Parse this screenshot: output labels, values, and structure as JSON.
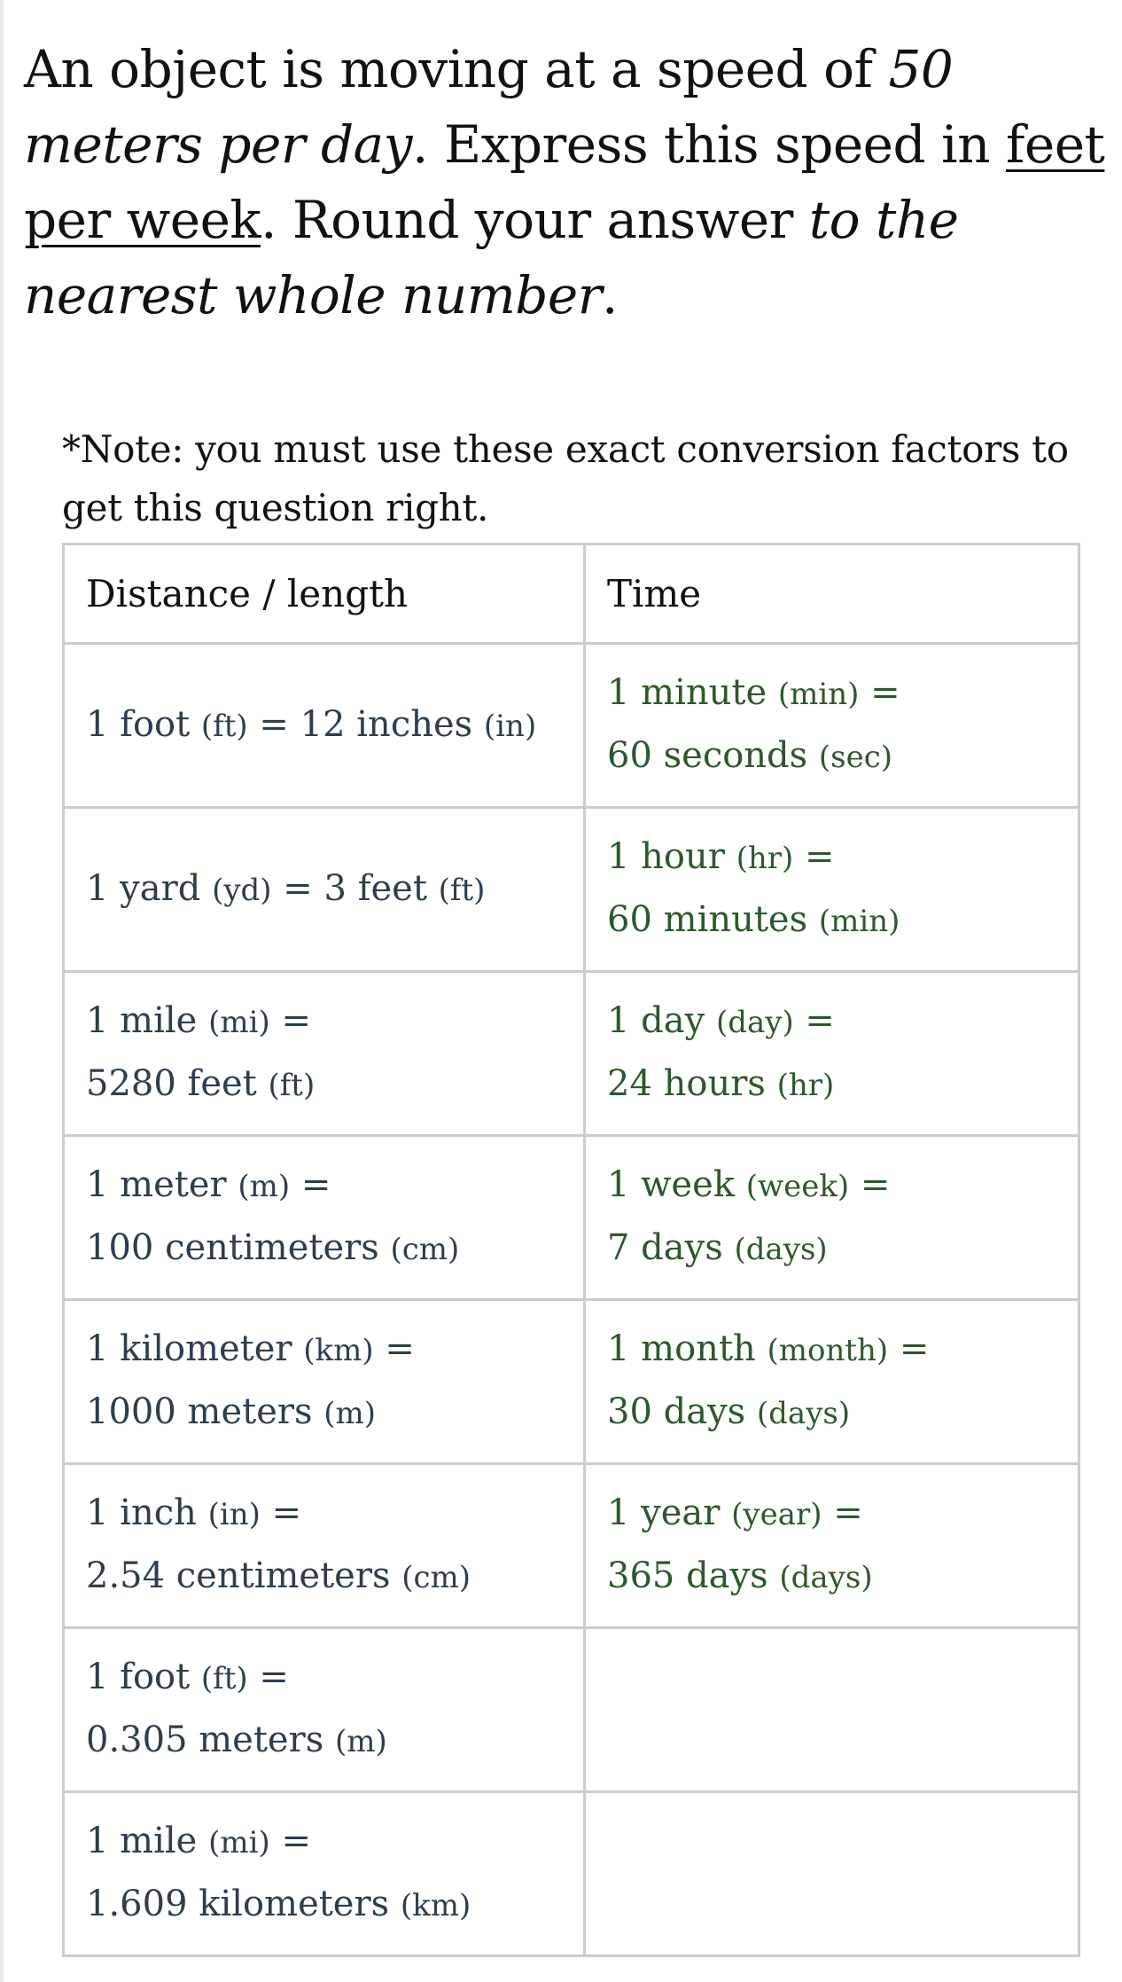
{
  "question": {
    "parts": [
      {
        "text": "An object is moving at a speed of ",
        "style": "normal"
      },
      {
        "text": "50 meters per day",
        "style": "italic"
      },
      {
        "text": ". Express this speed in ",
        "style": "normal"
      },
      {
        "text": "feet per week",
        "style": "underline"
      },
      {
        "text": ". Round your answer ",
        "style": "normal"
      },
      {
        "text": "to the nearest whole number",
        "style": "italic"
      },
      {
        "text": ".",
        "style": "normal"
      }
    ]
  },
  "note": "*Note: you must use these exact conversion factors to get this question right.",
  "colors": {
    "distance_text": "#2c3e50",
    "time_text": "#2b5a2a",
    "table_border": "#cccccc"
  },
  "table": {
    "headers": [
      "Distance / length",
      "Time"
    ],
    "rows": [
      {
        "distance": {
          "lines": [
            [
              [
                "1 foot ",
                ""
              ],
              [
                "(ft)",
                "unit"
              ],
              [
                " = 12 inches ",
                ""
              ],
              [
                "(in)",
                "unit"
              ]
            ]
          ]
        },
        "time": {
          "lines": [
            [
              [
                "1 minute ",
                ""
              ],
              [
                "(min)",
                "unit"
              ],
              [
                " =",
                ""
              ]
            ],
            [
              [
                "60 seconds ",
                ""
              ],
              [
                "(sec)",
                "unit"
              ]
            ]
          ]
        }
      },
      {
        "distance": {
          "lines": [
            [
              [
                "1 yard ",
                ""
              ],
              [
                "(yd)",
                "unit"
              ],
              [
                " = 3 feet ",
                ""
              ],
              [
                "(ft)",
                "unit"
              ]
            ]
          ]
        },
        "time": {
          "lines": [
            [
              [
                "1 hour ",
                ""
              ],
              [
                "(hr)",
                "unit"
              ],
              [
                " =",
                ""
              ]
            ],
            [
              [
                "60 minutes ",
                ""
              ],
              [
                "(min)",
                "unit"
              ]
            ]
          ]
        }
      },
      {
        "distance": {
          "lines": [
            [
              [
                "1 mile ",
                ""
              ],
              [
                "(mi)",
                "unit"
              ],
              [
                " =",
                ""
              ]
            ],
            [
              [
                "5280 feet ",
                ""
              ],
              [
                "(ft)",
                "unit"
              ]
            ]
          ]
        },
        "time": {
          "lines": [
            [
              [
                "1 day ",
                ""
              ],
              [
                "(day)",
                "unit"
              ],
              [
                " =",
                ""
              ]
            ],
            [
              [
                "24 hours ",
                ""
              ],
              [
                "(hr)",
                "unit"
              ]
            ]
          ]
        }
      },
      {
        "distance": {
          "lines": [
            [
              [
                "1 meter ",
                ""
              ],
              [
                "(m)",
                "unit"
              ],
              [
                " =",
                ""
              ]
            ],
            [
              [
                "100 centimeters ",
                ""
              ],
              [
                "(cm)",
                "unit"
              ]
            ]
          ]
        },
        "time": {
          "lines": [
            [
              [
                "1 week ",
                ""
              ],
              [
                "(week)",
                "unit"
              ],
              [
                " =",
                ""
              ]
            ],
            [
              [
                "7 days ",
                ""
              ],
              [
                "(days)",
                "unit"
              ]
            ]
          ]
        }
      },
      {
        "distance": {
          "lines": [
            [
              [
                "1 kilometer ",
                ""
              ],
              [
                "(km)",
                "unit"
              ],
              [
                " =",
                ""
              ]
            ],
            [
              [
                "1000 meters ",
                ""
              ],
              [
                "(m)",
                "unit"
              ]
            ]
          ]
        },
        "time": {
          "lines": [
            [
              [
                "1 month ",
                ""
              ],
              [
                "(month)",
                "unit"
              ],
              [
                " =",
                ""
              ]
            ],
            [
              [
                "30 days ",
                ""
              ],
              [
                "(days)",
                "unit"
              ]
            ]
          ]
        }
      },
      {
        "distance": {
          "lines": [
            [
              [
                "1 inch ",
                ""
              ],
              [
                "(in)",
                "unit"
              ],
              [
                " =",
                ""
              ]
            ],
            [
              [
                "2.54 centimeters ",
                ""
              ],
              [
                "(cm)",
                "unit"
              ]
            ]
          ]
        },
        "time": {
          "lines": [
            [
              [
                "1 year ",
                ""
              ],
              [
                "(year)",
                "unit"
              ],
              [
                " =",
                ""
              ]
            ],
            [
              [
                "365 days ",
                ""
              ],
              [
                "(days)",
                "unit"
              ]
            ]
          ]
        }
      },
      {
        "distance": {
          "lines": [
            [
              [
                "1 foot ",
                ""
              ],
              [
                "(ft)",
                "unit"
              ],
              [
                " =",
                ""
              ]
            ],
            [
              [
                "0.305 meters ",
                ""
              ],
              [
                "(m)",
                "unit"
              ]
            ]
          ]
        },
        "time": {
          "lines": []
        }
      },
      {
        "distance": {
          "lines": [
            [
              [
                "1 mile ",
                ""
              ],
              [
                "(mi)",
                "unit"
              ],
              [
                " =",
                ""
              ]
            ],
            [
              [
                "1.609 kilometers ",
                ""
              ],
              [
                "(km)",
                "unit"
              ]
            ]
          ]
        },
        "time": {
          "lines": []
        }
      }
    ]
  }
}
